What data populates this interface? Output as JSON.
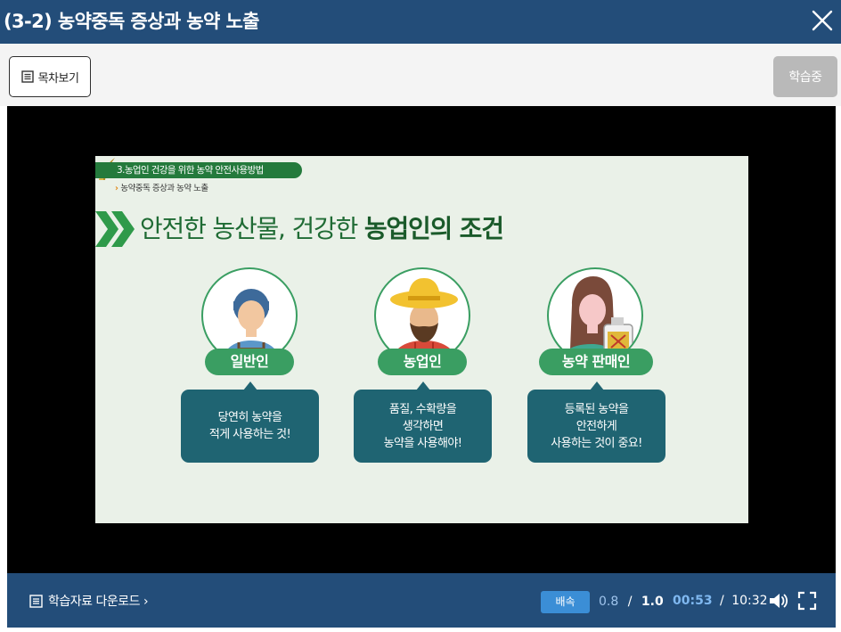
{
  "window": {
    "title": "(3-2) 농약중독 증상과 농약 노출"
  },
  "toolbar": {
    "toc_label": "목차보기",
    "status_label": "학습중"
  },
  "slide": {
    "breadcrumb": "3.농업인 건강을 위한 농약 안전사용방법",
    "sub_breadcrumb": "농약중독 증상과 농약 노출",
    "title_plain": "안전한 농산물, 건강한 ",
    "title_strong": "농업인의 조건",
    "cards": [
      {
        "role": "일반인",
        "lines": [
          "당연히 농약을",
          "적게 사용하는 것!"
        ]
      },
      {
        "role": "농업인",
        "lines": [
          "품질, 수확량을",
          "생각하면",
          "농약을 사용해야!"
        ]
      },
      {
        "role": "농약 판매인",
        "lines": [
          "등록된 농약을",
          "안전하게",
          "사용하는 것이 중요!"
        ]
      }
    ]
  },
  "controls": {
    "download_label": "학습자료 다운로드 ›",
    "speed_label": "배속",
    "speed_current": "0.8",
    "speed_separator": "/",
    "speed_max": "1.0",
    "time_current": "00:53",
    "time_separator": "/",
    "time_total": "10:32"
  },
  "colors": {
    "header": "#234d79",
    "accent_green": "#3a9e62",
    "bubble": "#1f6472",
    "speed_badge": "#3b8ed6"
  }
}
